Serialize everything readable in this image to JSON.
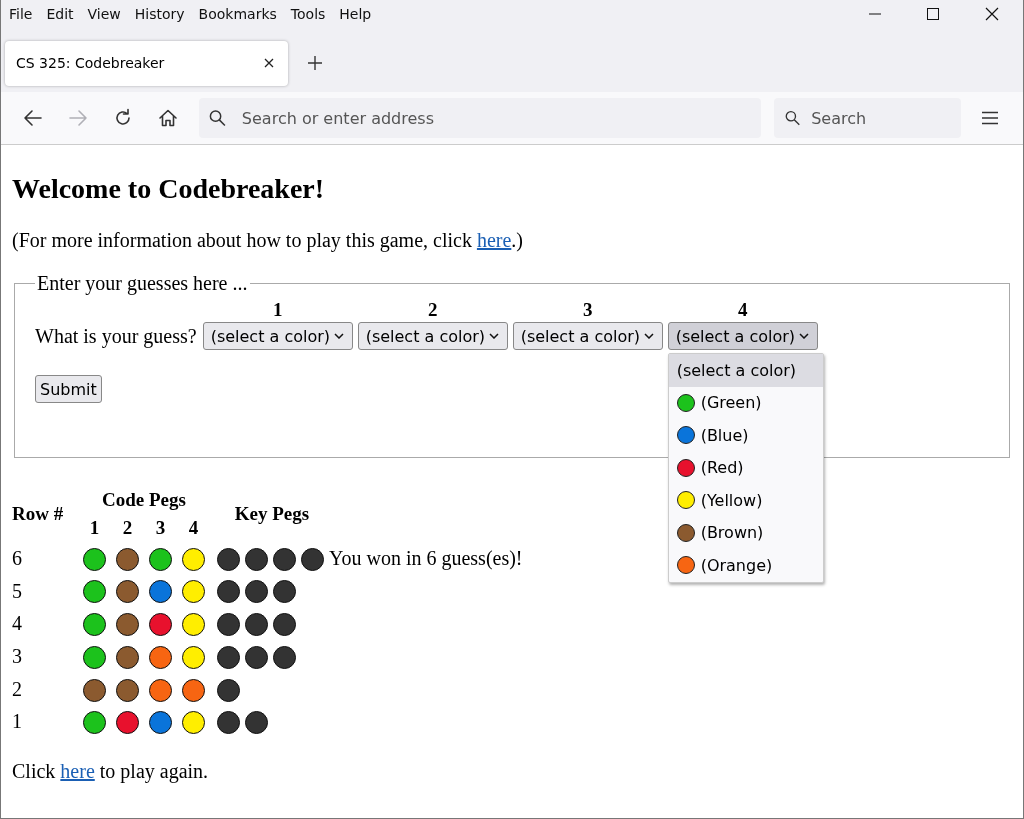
{
  "menu_bar": [
    "File",
    "Edit",
    "View",
    "History",
    "Bookmarks",
    "Tools",
    "Help"
  ],
  "tabs": [
    {
      "label": "CS 325: Codebreaker",
      "selected": true
    }
  ],
  "nav_buttons": [
    {
      "kind": "back",
      "disabled": false
    },
    {
      "kind": "forward",
      "disabled": true
    },
    {
      "kind": "reload",
      "disabled": false
    },
    {
      "kind": "home",
      "disabled": false
    }
  ],
  "toolbar": {
    "address_placeholder": "Search or enter address",
    "search_placeholder": "Search"
  },
  "page": {
    "heading": "Welcome to Codebreaker!",
    "intro": {
      "before": "(For more information about how to play this game, click ",
      "link": "here",
      "after": ".)"
    },
    "guess_form": {
      "legend": "Enter your guesses here ...",
      "prompt": "What is your guess?",
      "slots": [
        {
          "label": "1",
          "value": "(select a color)",
          "expanded": false
        },
        {
          "label": "2",
          "value": "(select a color)",
          "expanded": false
        },
        {
          "label": "3",
          "value": "(select a color)",
          "expanded": false
        },
        {
          "label": "4",
          "value": "(select a color)",
          "expanded": true
        }
      ],
      "dropdown_options": [
        {
          "label": "(select a color)",
          "selected": true
        },
        {
          "label": "(Green)",
          "color": "#1cc21c",
          "selected": false
        },
        {
          "label": "(Blue)",
          "color": "#0a74da",
          "selected": false
        },
        {
          "label": "(Red)",
          "color": "#e8112d",
          "selected": false
        },
        {
          "label": "(Yellow)",
          "color": "#ffee00",
          "selected": false
        },
        {
          "label": "(Brown)",
          "color": "#8b5a2f",
          "selected": false
        },
        {
          "label": "(Orange)",
          "color": "#f76512",
          "selected": false
        }
      ],
      "submit": "Submit"
    },
    "history": {
      "headers": {
        "row": "Row #",
        "code_pegs": "Code Pegs",
        "key_pegs": "Key Pegs",
        "positions": [
          "1",
          "2",
          "3",
          "4"
        ]
      },
      "rows": [
        {
          "number": "6",
          "code_pegs": [
            {
              "color": "#1cc21c"
            },
            {
              "color": "#8b5a2f"
            },
            {
              "color": "#1cc21c"
            },
            {
              "color": "#ffee00"
            }
          ],
          "key_pegs": [
            {
              "color": "#333333"
            },
            {
              "color": "#333333"
            },
            {
              "color": "#333333"
            },
            {
              "color": "#333333"
            }
          ],
          "message": "You won in 6 guess(es)!"
        },
        {
          "number": "5",
          "code_pegs": [
            {
              "color": "#1cc21c"
            },
            {
              "color": "#8b5a2f"
            },
            {
              "color": "#0a74da"
            },
            {
              "color": "#ffee00"
            }
          ],
          "key_pegs": [
            {
              "color": "#333333"
            },
            {
              "color": "#333333"
            },
            {
              "color": "#333333"
            }
          ]
        },
        {
          "number": "4",
          "code_pegs": [
            {
              "color": "#1cc21c"
            },
            {
              "color": "#8b5a2f"
            },
            {
              "color": "#e8112d"
            },
            {
              "color": "#ffee00"
            }
          ],
          "key_pegs": [
            {
              "color": "#333333"
            },
            {
              "color": "#333333"
            },
            {
              "color": "#333333"
            }
          ]
        },
        {
          "number": "3",
          "code_pegs": [
            {
              "color": "#1cc21c"
            },
            {
              "color": "#8b5a2f"
            },
            {
              "color": "#f76512"
            },
            {
              "color": "#ffee00"
            }
          ],
          "key_pegs": [
            {
              "color": "#333333"
            },
            {
              "color": "#333333"
            },
            {
              "color": "#333333"
            }
          ]
        },
        {
          "number": "2",
          "code_pegs": [
            {
              "color": "#8b5a2f"
            },
            {
              "color": "#8b5a2f"
            },
            {
              "color": "#f76512"
            },
            {
              "color": "#f76512"
            }
          ],
          "key_pegs": [
            {
              "color": "#333333"
            }
          ]
        },
        {
          "number": "1",
          "code_pegs": [
            {
              "color": "#1cc21c"
            },
            {
              "color": "#e8112d"
            },
            {
              "color": "#0a74da"
            },
            {
              "color": "#ffee00"
            }
          ],
          "key_pegs": [
            {
              "color": "#333333"
            },
            {
              "color": "#333333"
            }
          ]
        }
      ]
    },
    "footer": {
      "before": "Click ",
      "link": "here",
      "after": " to play again."
    }
  }
}
